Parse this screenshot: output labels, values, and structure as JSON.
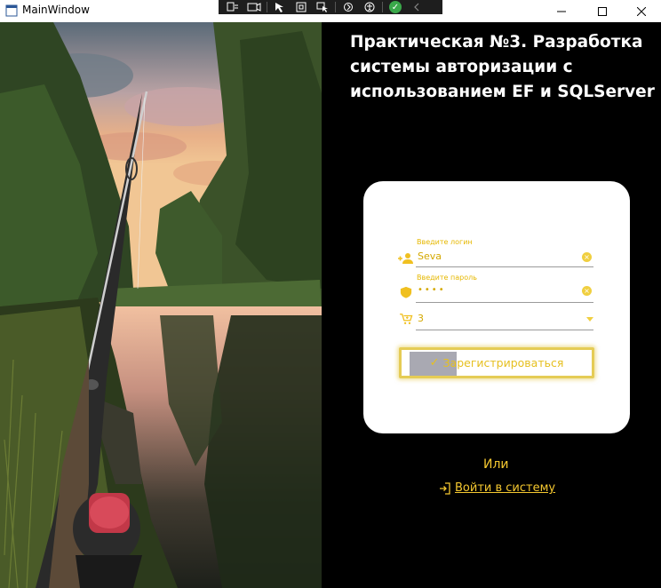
{
  "window": {
    "title": "MainWindow",
    "caption_buttons": [
      "minimize",
      "maximize",
      "close"
    ]
  },
  "debug_toolbar": {
    "icons": [
      "live-visual-tree-icon",
      "record-icon",
      "select-element-icon",
      "display-layout-adorners-icon",
      "track-focus-icon",
      "hot-reload-icon",
      "accessibility-checker-icon",
      "binding-failures-check-icon",
      "collapse-toolbar-icon"
    ]
  },
  "page": {
    "title": "Практическая  №3. Разработка\nсистемы авторизации с\nиспользованием EF и SQLServer"
  },
  "form": {
    "login": {
      "hint": "Введите логин",
      "value": "Seva",
      "icon": "add-user-icon"
    },
    "password": {
      "hint": "Введите пароль",
      "value": "••••",
      "icon": "shield-icon"
    },
    "role": {
      "value": "3",
      "icon": "cart-plus-icon"
    },
    "register_button": {
      "label": "Зарегистрироваться",
      "icon": "check-icon",
      "progress": 0.27
    }
  },
  "footer": {
    "or_text": "Или",
    "login_link": "Войти в систему",
    "login_icon": "login-icon"
  },
  "colors": {
    "accent": "#f5c830",
    "background": "#000000",
    "card": "#ffffff"
  }
}
